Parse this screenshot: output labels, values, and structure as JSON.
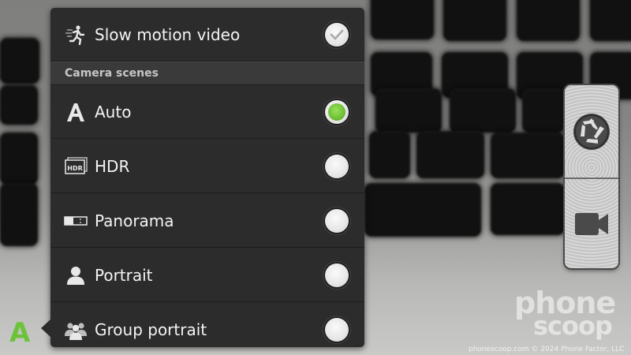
{
  "menu": {
    "top_item": {
      "label": "Slow motion video",
      "icon": "slow-motion-runner-icon",
      "checked": true
    },
    "section_title": "Camera scenes",
    "scenes": [
      {
        "label": "Auto",
        "icon": "auto-a-icon",
        "selected": true
      },
      {
        "label": "HDR",
        "icon": "hdr-icon",
        "selected": false
      },
      {
        "label": "Panorama",
        "icon": "panorama-icon",
        "selected": false
      },
      {
        "label": "Portrait",
        "icon": "portrait-icon",
        "selected": false
      },
      {
        "label": "Group portrait",
        "icon": "group-portrait-icon",
        "selected": false
      }
    ]
  },
  "current_scene_indicator": "A",
  "shutter": {
    "photo_icon": "aperture-icon",
    "video_icon": "video-camera-icon"
  },
  "watermark": {
    "line1": "phone",
    "line2": "scoop",
    "footer": "phonescoop.com  © 2024 Phone Factor, LLC"
  },
  "colors": {
    "accent_green": "#6cbf36",
    "panel_bg": "#2c2c2c",
    "label_white": "#f4f4f4"
  }
}
